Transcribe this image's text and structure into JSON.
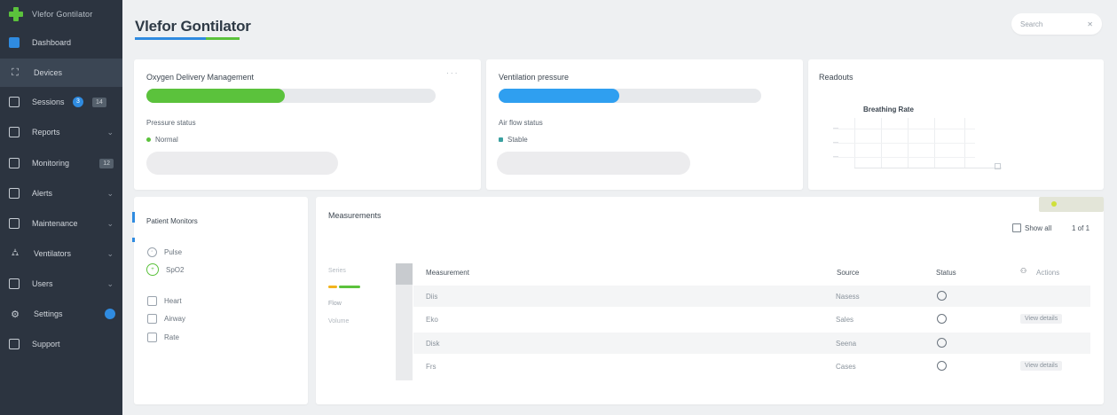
{
  "sidebar": {
    "brand": "Vlefor Gontilator",
    "items": [
      {
        "label": "Dashboard",
        "icon": "dashboard-icon"
      },
      {
        "label": "Devices",
        "icon": "devices-icon"
      },
      {
        "label": "Sessions",
        "icon": "sessions-icon",
        "badge": "3",
        "badge2": "14"
      },
      {
        "label": "Reports",
        "icon": "reports-icon"
      },
      {
        "label": "Monitoring",
        "icon": "monitoring-icon",
        "badge": "12"
      },
      {
        "label": "Alerts",
        "icon": "alerts-icon"
      },
      {
        "label": "Maintenance",
        "icon": "maintenance-icon"
      },
      {
        "label": "Ventilators",
        "icon": "ventilators-icon"
      },
      {
        "label": "Users",
        "icon": "users-icon"
      },
      {
        "label": "Settings",
        "icon": "settings-icon"
      },
      {
        "label": "Support",
        "icon": "support-icon"
      }
    ]
  },
  "header": {
    "title": "Vlefor Gontilator",
    "search_placeholder": "Search",
    "search_close": "✕"
  },
  "card1": {
    "title": "Oxygen Delivery Management",
    "more": "· · ·",
    "sub": "Pressure status",
    "status": "Normal",
    "progress": 0.48
  },
  "card2": {
    "title": "Ventilation pressure",
    "sub": "Air flow status",
    "status": "Stable",
    "progress": 0.46
  },
  "card3": {
    "title": "Readouts",
    "chart_title": "Breathing Rate"
  },
  "left_card": {
    "title": "Patient Monitors",
    "items": [
      "Pulse",
      "SpO2",
      "Heart",
      "Airway",
      "Rate"
    ]
  },
  "table_card": {
    "title": "Measurements",
    "filter_label": "Show all",
    "filter_count": "1 of 1",
    "legend": [
      "Series",
      "Flow",
      "Volume"
    ],
    "columns": [
      "Measurement",
      "Source",
      "Status",
      "Actions"
    ],
    "rows": [
      {
        "name": "Diis",
        "source": "Nasess",
        "action": ""
      },
      {
        "name": "Eko",
        "source": "Sales",
        "action": "View details"
      },
      {
        "name": "Disk",
        "source": "Seena",
        "action": ""
      },
      {
        "name": "Frs",
        "source": "Cases",
        "action": "View details"
      }
    ]
  },
  "colors": {
    "green": "#5bc23c",
    "blue": "#2f8be0",
    "sidebar": "#2c3440"
  }
}
